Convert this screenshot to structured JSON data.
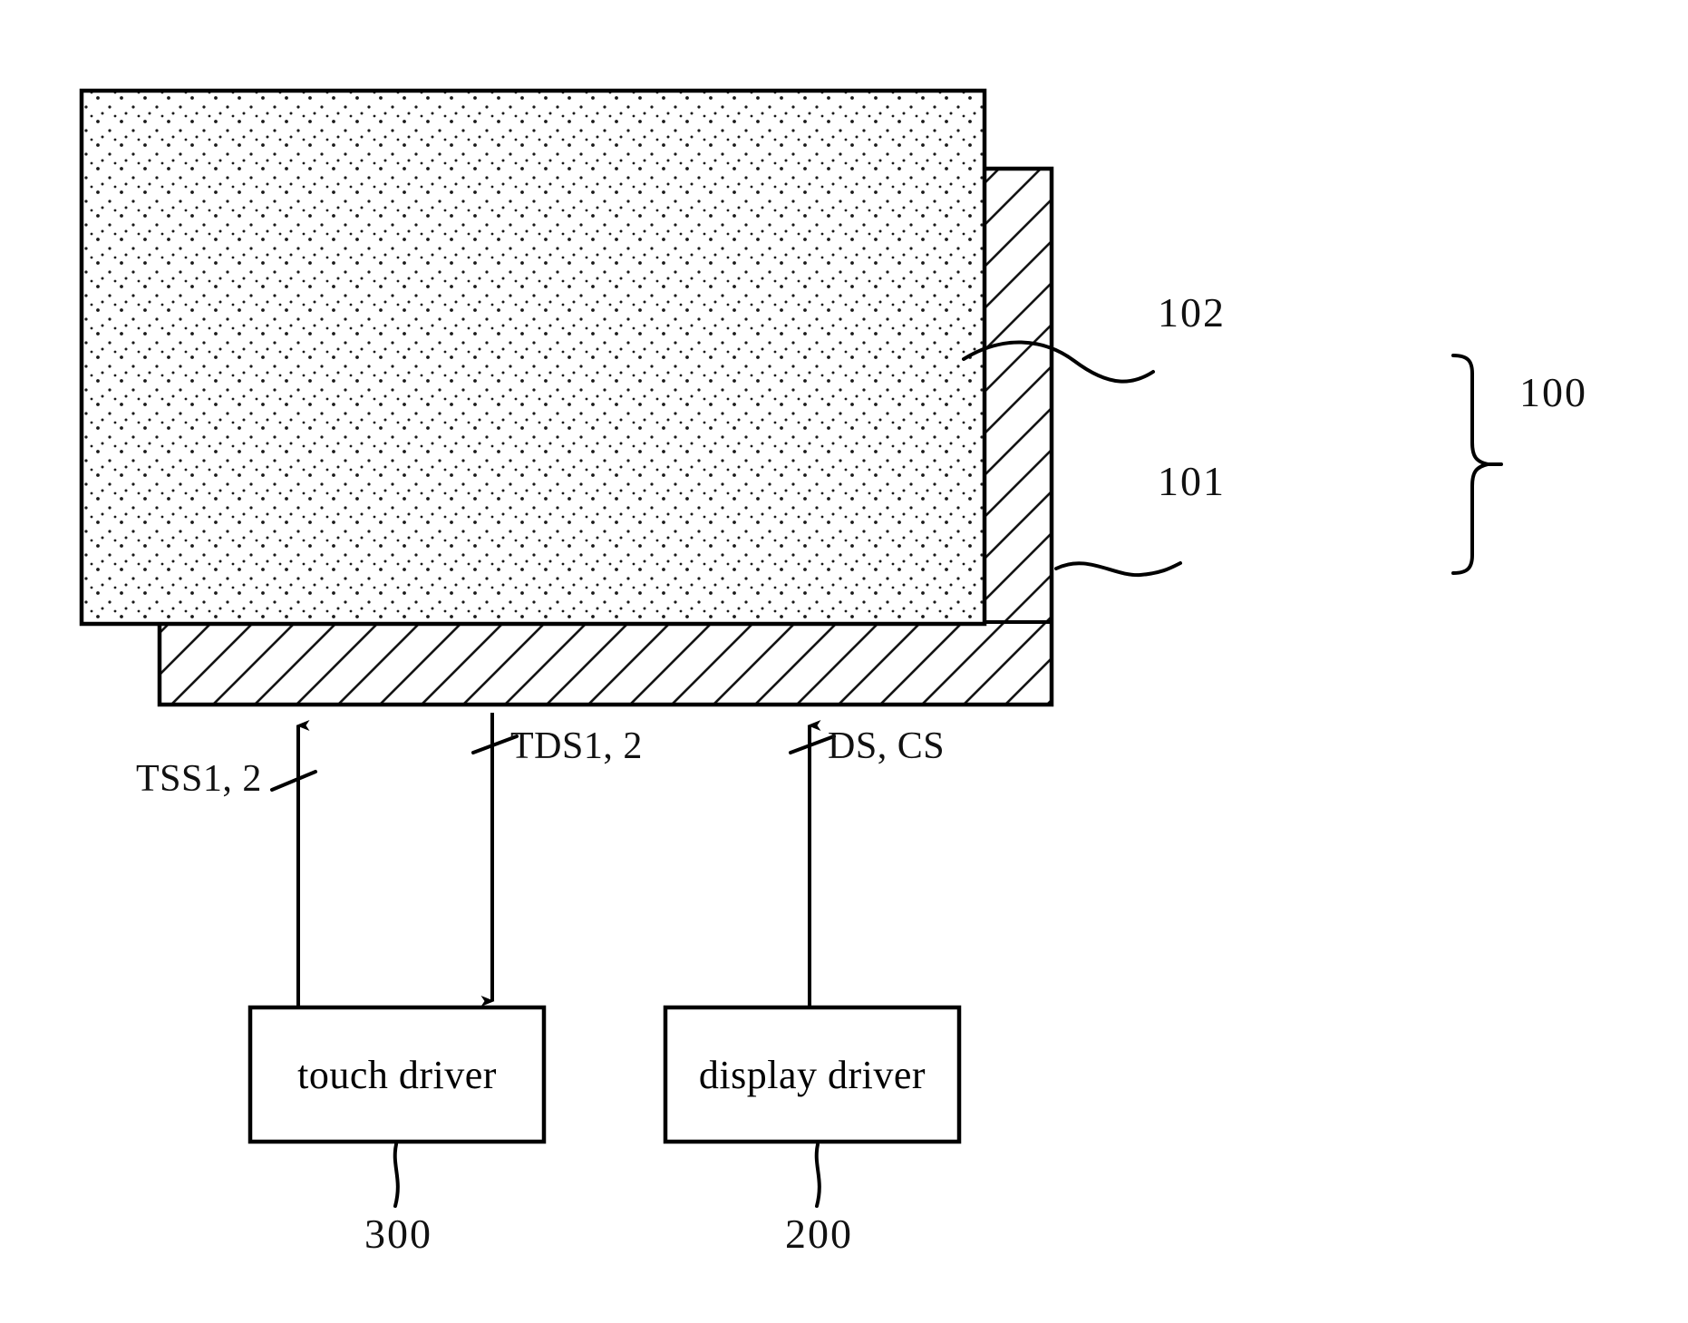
{
  "figure": {
    "type": "patent-diagram",
    "background_color": "#ffffff",
    "line_color": "#000000"
  },
  "panel": {
    "name": "display-panel-stack",
    "top_layer_ref": "102",
    "bottom_layer_ref": "101",
    "group_ref": "100"
  },
  "reference_numerals": {
    "layer_top": "102",
    "layer_bottom": "101",
    "assembly": "100",
    "touch_driver": "300",
    "display_driver": "200"
  },
  "signals": {
    "touch_sense": "TSS1, 2",
    "touch_drive": "TDS1, 2",
    "display": "DS, CS"
  },
  "blocks": {
    "touch_driver": "touch driver",
    "display_driver": "display driver"
  }
}
